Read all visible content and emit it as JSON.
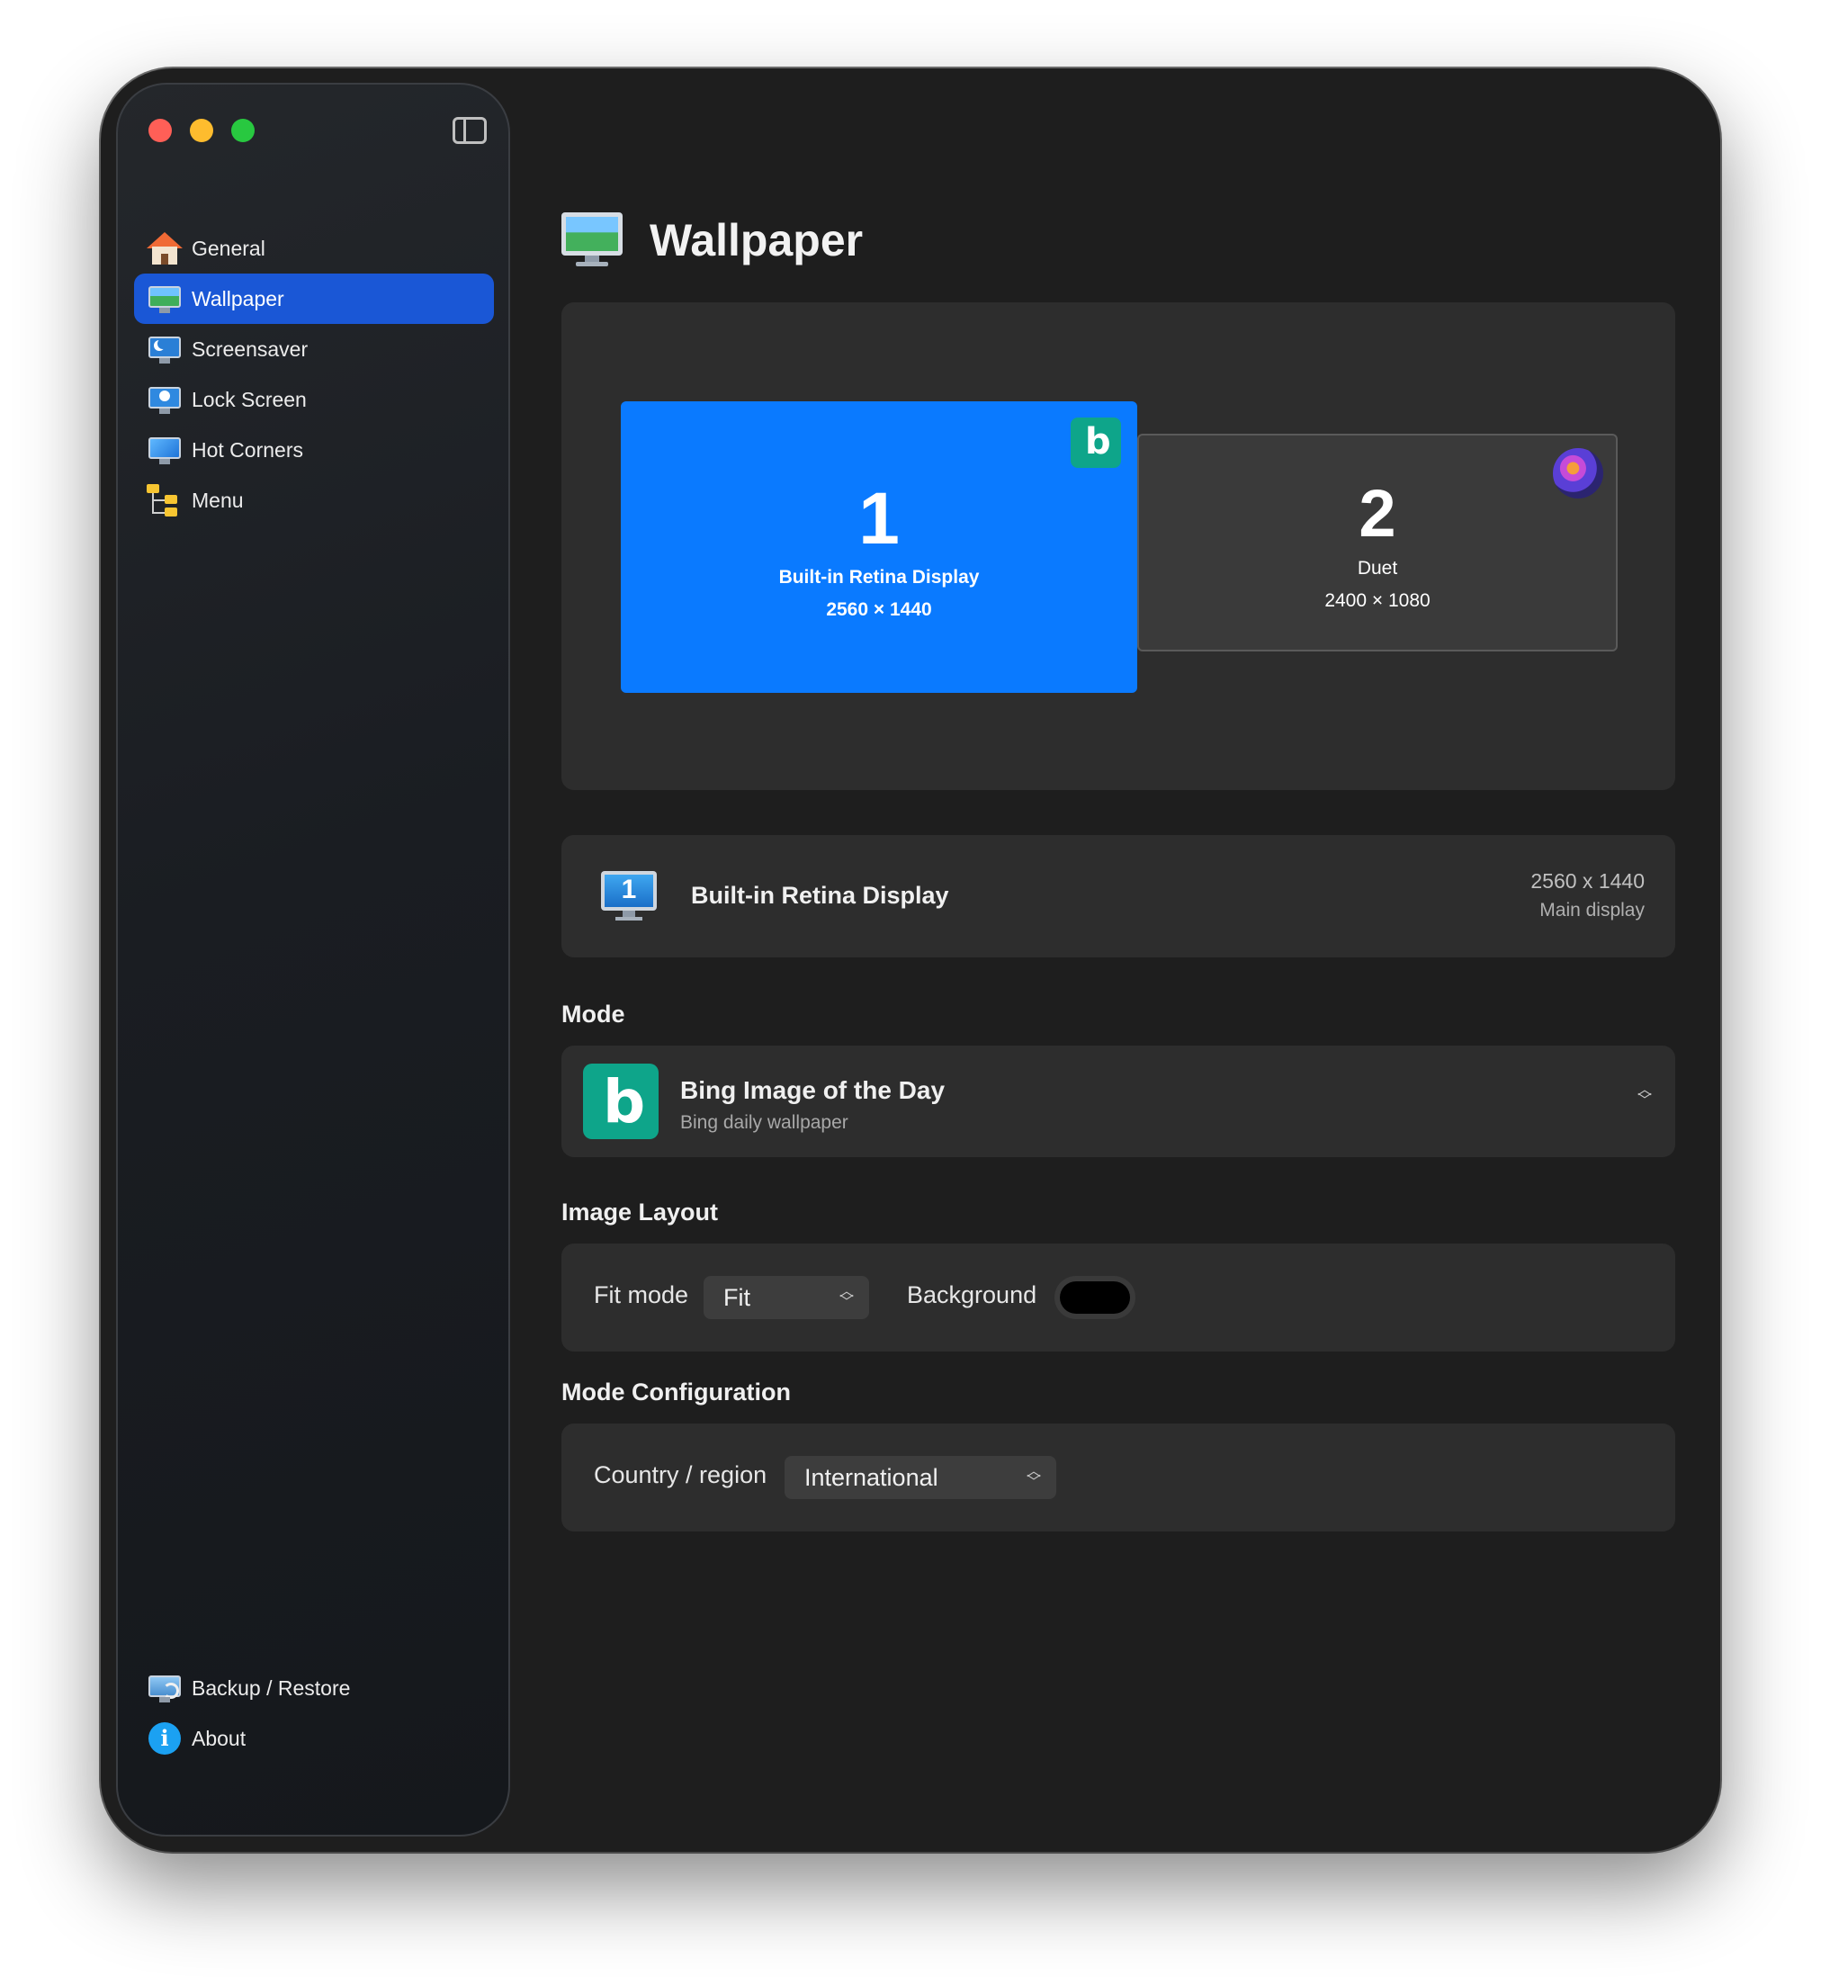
{
  "sidebar": {
    "items": [
      {
        "label": "General",
        "icon": "house-icon"
      },
      {
        "label": "Wallpaper",
        "icon": "wallpaper-monitor-icon",
        "active": true
      },
      {
        "label": "Screensaver",
        "icon": "screensaver-moon-icon"
      },
      {
        "label": "Lock Screen",
        "icon": "lock-screen-icon"
      },
      {
        "label": "Hot Corners",
        "icon": "hot-corners-icon"
      },
      {
        "label": "Menu",
        "icon": "menu-folders-icon"
      }
    ],
    "bottom_items": [
      {
        "label": "Backup / Restore",
        "icon": "backup-restore-icon"
      },
      {
        "label": "About",
        "icon": "info-icon"
      }
    ]
  },
  "header": {
    "title": "Wallpaper"
  },
  "arrangement": {
    "displays": [
      {
        "number": "1",
        "name": "Built-in Retina Display",
        "resolution": "2560 × 1440",
        "selected": true,
        "source_icon": "bing-icon"
      },
      {
        "number": "2",
        "name": "Duet",
        "resolution": "2400 × 1080",
        "selected": false,
        "source_icon": "galaxy-icon"
      }
    ]
  },
  "selected_display": {
    "number": "1",
    "title": "Built-in Retina Display",
    "resolution": "2560 x 1440",
    "subtitle": "Main display"
  },
  "mode": {
    "section_label": "Mode",
    "title": "Bing Image of the Day",
    "subtitle": "Bing daily wallpaper",
    "b_glyph": "b"
  },
  "image_layout": {
    "section_label": "Image Layout",
    "fit_label": "Fit mode",
    "fit_value": "Fit",
    "background_label": "Background",
    "background_color": "#000000"
  },
  "mode_config": {
    "section_label": "Mode Configuration",
    "country_label": "Country / region",
    "country_value": "International"
  },
  "colors": {
    "accent": "#1a57d6",
    "display_selected": "#0a7aff",
    "bing_green": "#0ea58a",
    "window_bg": "#1e1e1e",
    "panel_bg": "#2d2d2d"
  }
}
